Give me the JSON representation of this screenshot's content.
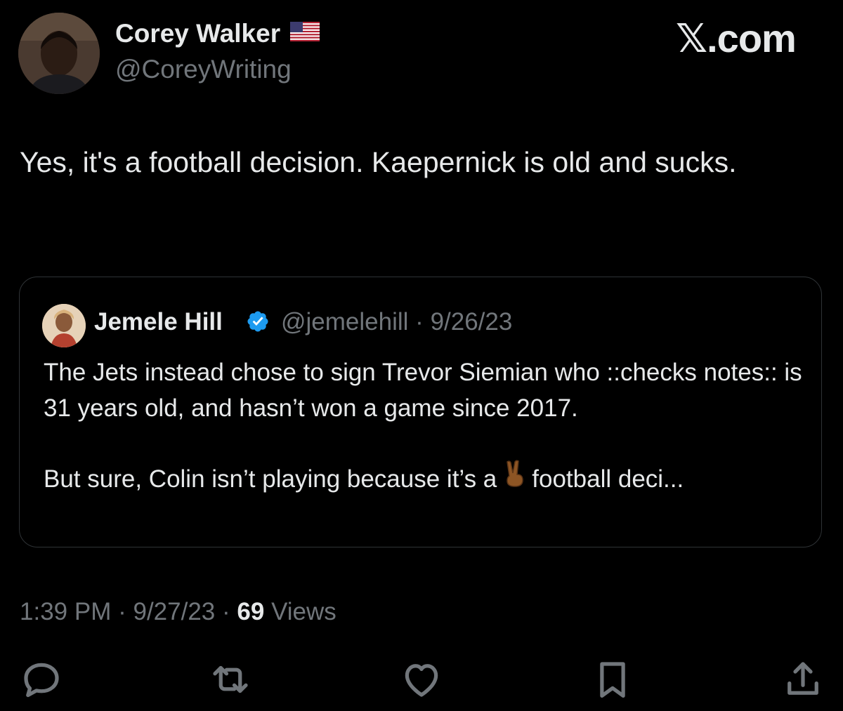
{
  "author": {
    "display_name": "Corey Walker",
    "flag_icon": "us-flag-icon",
    "handle": "@CoreyWriting"
  },
  "brand": "𝕏.com",
  "tweet": {
    "text": "Yes, it's a football decision. Kaepernick is old and sucks."
  },
  "quoted_tweet": {
    "display_name": "Jemele Hill",
    "verified_icon": "verified-badge-icon",
    "handle": "@jemelehill",
    "separator": "·",
    "date": "9/26/23",
    "paragraph_1": "The Jets instead chose to sign Trevor Siemian who ::checks notes:: is 31 years old, and hasn’t won a game since 2017.",
    "paragraph_2_before": "But sure, Colin isn’t playing because it’s a",
    "paragraph_2_emoji_icon": "victory-hand-icon",
    "paragraph_2_after": "football deci..."
  },
  "meta": {
    "time": "1:39 PM",
    "separator": "·",
    "date": "9/27/23",
    "views_count": "69",
    "views_label": "Views"
  },
  "actions": [
    {
      "icon": "reply-icon"
    },
    {
      "icon": "retweet-icon"
    },
    {
      "icon": "like-icon"
    },
    {
      "icon": "bookmark-icon"
    },
    {
      "icon": "share-icon"
    }
  ],
  "colors": {
    "background": "#000000",
    "text_primary": "#e7e9ea",
    "text_secondary": "#71767b",
    "border": "#2f3336",
    "verified_blue": "#1d9bf0"
  }
}
